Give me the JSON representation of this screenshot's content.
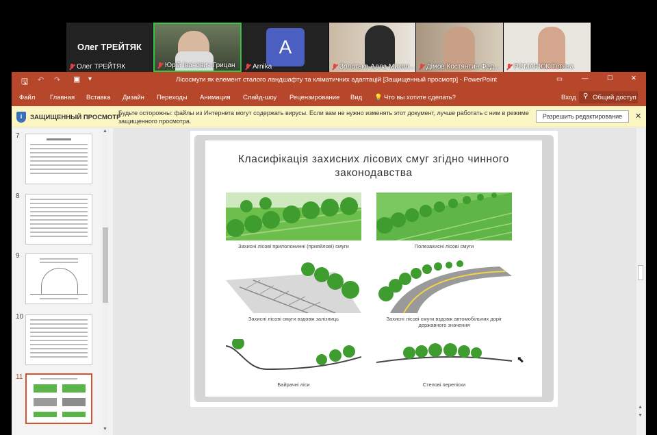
{
  "participants": [
    {
      "display": "Олег ТРЕЙТЯК",
      "name": "Олег ТРЕЙТЯК",
      "muted": true
    },
    {
      "name": "Юрій Іванович Грицан",
      "muted": true,
      "active": true
    },
    {
      "initial": "A",
      "name": "Arnika",
      "muted": true
    },
    {
      "name": "Золотько Алла Микол...",
      "muted": true
    },
    {
      "name": "Дімов Костянтин Фед...",
      "muted": true
    },
    {
      "name": "РОМАНЮК Тетяна",
      "muted": true
    }
  ],
  "window": {
    "title": "Лісосмуги як елемент сталого ландшафту та кліматичних адаптацій [Защищенный просмотр] - PowerPoint",
    "menu": [
      "Файл",
      "Главная",
      "Вставка",
      "Дизайн",
      "Переходы",
      "Анимация",
      "Слайд-шоу",
      "Рецензирование",
      "Вид"
    ],
    "search": "Что вы хотите сделать?",
    "signin": "Вход",
    "share": "Общий доступ"
  },
  "protected_view": {
    "label": "ЗАЩИЩЕННЫЙ ПРОСМОТР",
    "message": "Будьте осторожны: файлы из Интернета могут содержать вирусы. Если вам не нужно изменять этот документ, лучше работать с ним в режиме защищенного просмотра.",
    "button": "Разрешить редактирование"
  },
  "slides_panel": {
    "numbers": [
      "7",
      "8",
      "9",
      "10",
      "11"
    ],
    "selected": "11"
  },
  "slide": {
    "title": "Класифікація захисних лісових смуг згідно чинного законодавства",
    "captions": [
      "Захисні лісові прилолонинні (прияйлові) смуги",
      "Полезахисні лісові смуги",
      "Захисні лісові смуги вздовж залізниць",
      "Захисні лісові смуги вздовж автомобільних доріг державного значення",
      "Байрачні ліси",
      "Степові переліски"
    ]
  },
  "colors": {
    "ppt_accent": "#b7472a",
    "tree_green": "#4caf3a",
    "banner": "#fcf5c4"
  }
}
